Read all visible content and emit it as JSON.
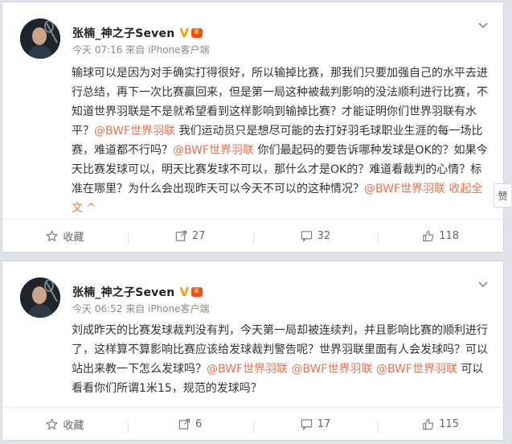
{
  "posts": [
    {
      "author": "张楠_神之子Seven",
      "verified": "V",
      "meta": "今天 07:16 来自 iPhone客户端",
      "segments": [
        {
          "t": "text",
          "v": "输球可以是因为对手确实打得很好，所以输掉比赛，那我们只要加强自己的水平去进行总结，再下一次比赛赢回来，但是第一局这种被裁判影响的没法顺利进行比赛，不知道世界羽联是不是就希望看到这样影响到输掉比赛？才能证明你们世界羽联有水平？"
        },
        {
          "t": "mention",
          "v": "@BWF世界羽联"
        },
        {
          "t": "text",
          "v": " 我们运动员只是想尽可能的去打好羽毛球职业生涯的每一场比赛，难道都不行吗？"
        },
        {
          "t": "mention",
          "v": "@BWF世界羽联"
        },
        {
          "t": "text",
          "v": " 你们最起码的要告诉哪种发球是OK的？如果今天比赛发球可以，明天比赛发球不可以，那什么才是OK的？难道看裁判的心情？标准在哪里？为什么会出现昨天可以今天不可以的这种情况？"
        },
        {
          "t": "mention",
          "v": "@BWF世界羽联"
        },
        {
          "t": "link",
          "v": " 收起全文 ^"
        }
      ],
      "actions": {
        "favorite": "收藏",
        "repost": "27",
        "comment": "32",
        "like": "118"
      }
    },
    {
      "author": "张楠_神之子Seven",
      "verified": "V",
      "meta": "今天 06:52 来自 iPhone客户端",
      "segments": [
        {
          "t": "text",
          "v": "刘成昨天的比赛发球裁判没有判，今天第一局却被连续判，并且影响比赛的顺利进行了，这样算不算影响比赛应该给发球裁判警告呢？世界羽联里面有人会发球吗？可以站出来教一下怎么发球吗？"
        },
        {
          "t": "mention",
          "v": "@BWF世界羽联"
        },
        {
          "t": "text",
          "v": " "
        },
        {
          "t": "mention",
          "v": "@BWF世界羽联"
        },
        {
          "t": "text",
          "v": " "
        },
        {
          "t": "mention",
          "v": "@BWF世界羽联"
        },
        {
          "t": "text",
          "v": " 可以看看你们所谓1米15，规范的发球吗？"
        }
      ],
      "actions": {
        "favorite": "收藏",
        "repost": "6",
        "comment": "17",
        "like": "115"
      }
    }
  ],
  "side_like": "赞",
  "colors": {
    "mention": "#eb7350",
    "verified": "#f5a000"
  }
}
